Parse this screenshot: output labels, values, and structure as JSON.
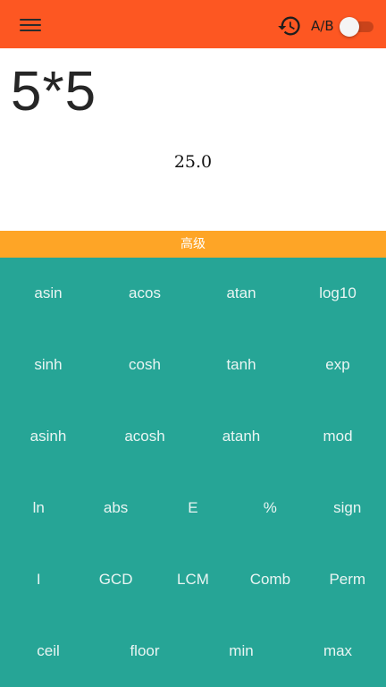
{
  "toolbar": {
    "menu_icon": "hamburger-menu-icon",
    "history_icon": "history-icon",
    "ab_label": "A/B",
    "ab_toggle_on": false,
    "background": "#fd5722"
  },
  "display": {
    "expression": "5*5",
    "result": "25.0"
  },
  "mode_bar": {
    "label": "高级",
    "background": "#fea526"
  },
  "keypad": {
    "background": "#26a596",
    "rows": [
      [
        "asin",
        "acos",
        "atan",
        "log10"
      ],
      [
        "sinh",
        "cosh",
        "tanh",
        "exp"
      ],
      [
        "asinh",
        "acosh",
        "atanh",
        "mod"
      ],
      [
        "ln",
        "abs",
        "E",
        "%",
        "sign"
      ],
      [
        "I",
        "GCD",
        "LCM",
        "Comb",
        "Perm"
      ],
      [
        "ceil",
        "floor",
        "min",
        "max"
      ]
    ]
  }
}
